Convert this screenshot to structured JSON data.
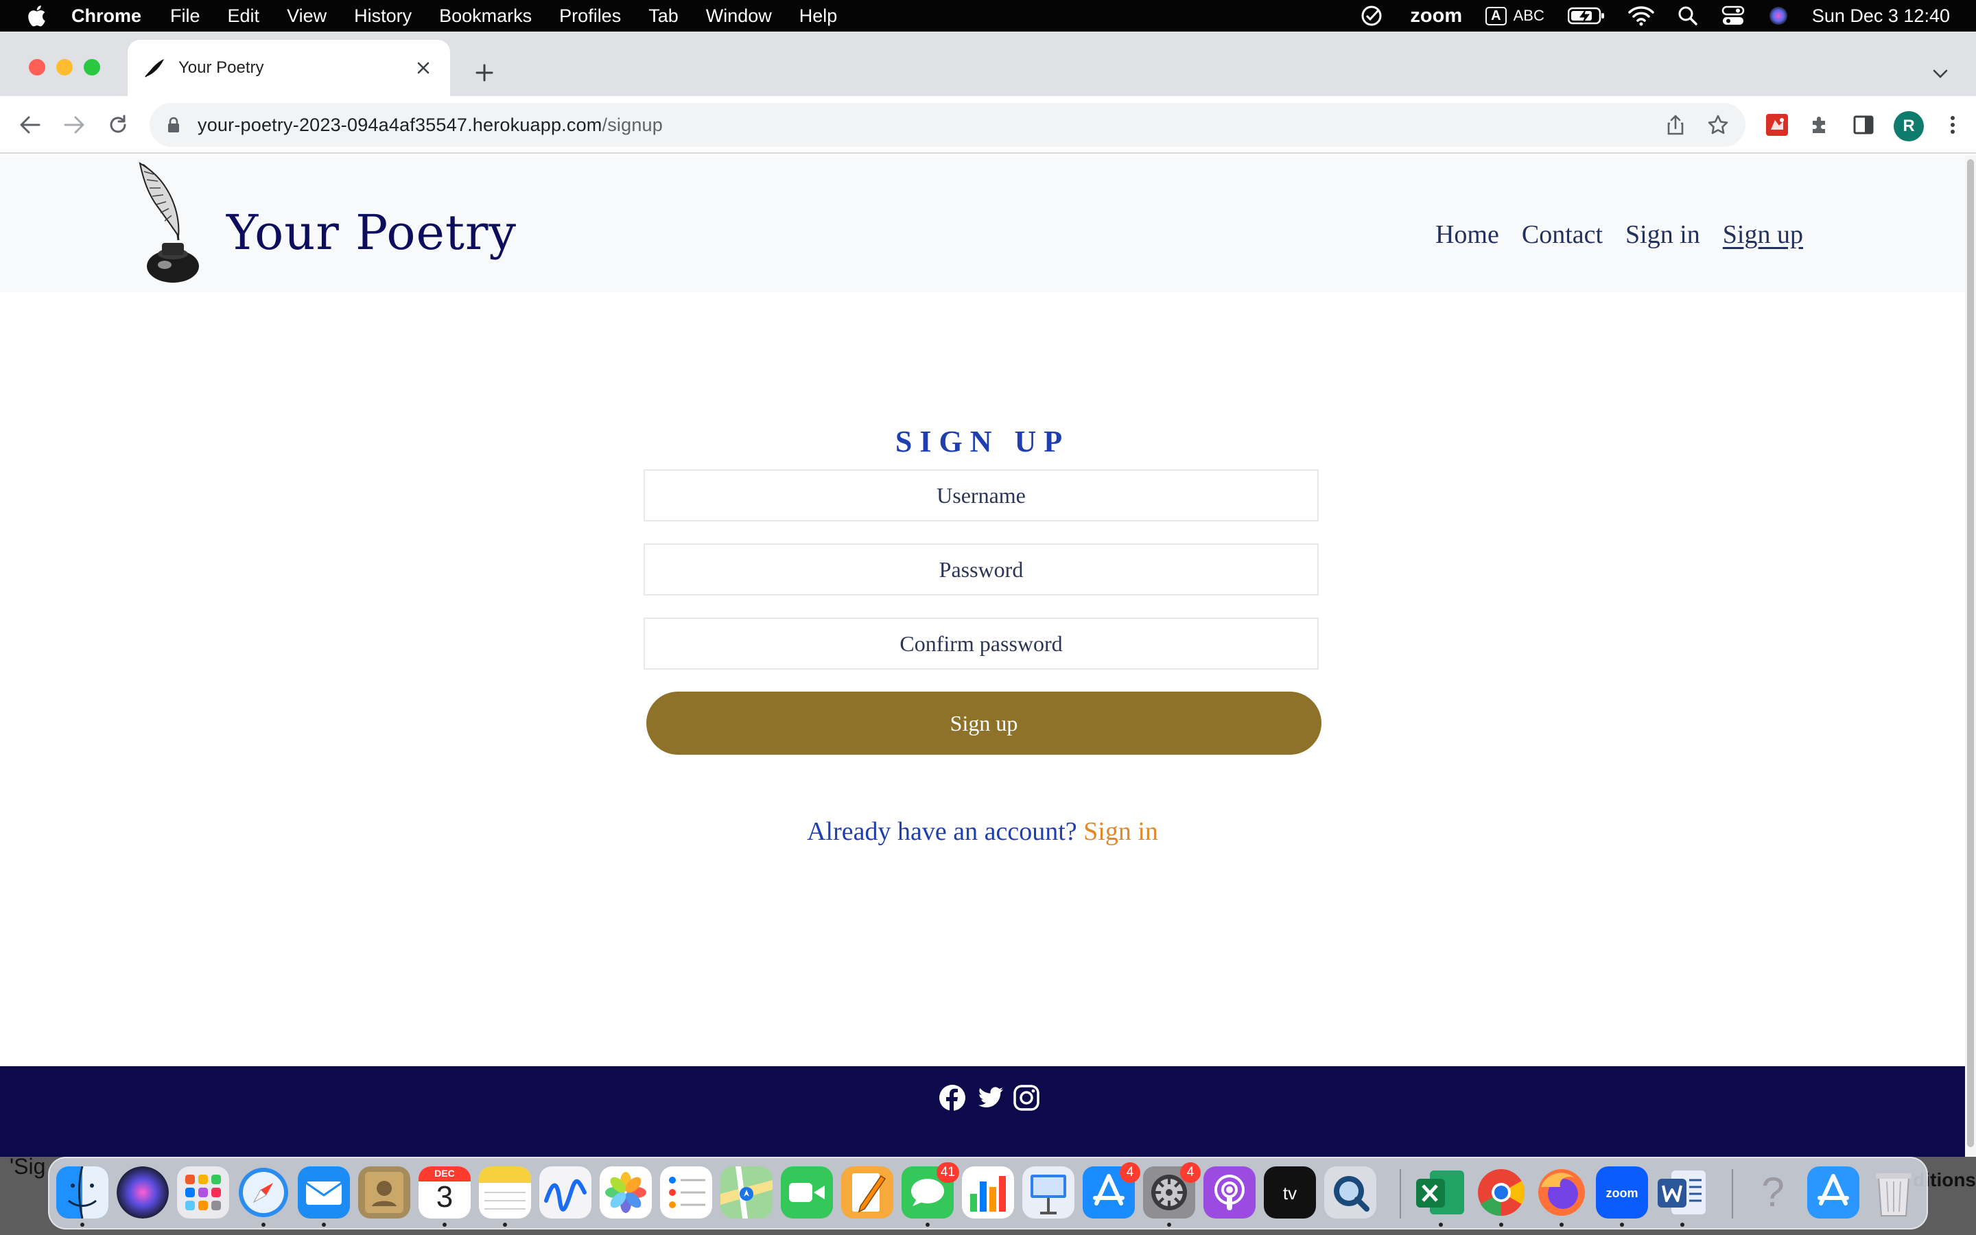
{
  "menubar": {
    "app_name": "Chrome",
    "items": [
      "File",
      "Edit",
      "View",
      "History",
      "Bookmarks",
      "Profiles",
      "Tab",
      "Window",
      "Help"
    ],
    "zoom_label": "zoom",
    "input_source": "A",
    "input_label": "ABC",
    "clock": "Sun Dec 3  12:40"
  },
  "browser": {
    "tab_title": "Your Poetry",
    "url_host": "your-poetry-2023-094a4af35547.herokuapp.com",
    "url_path": "/signup",
    "profile_initial": "R"
  },
  "site": {
    "brand": "Your Poetry",
    "nav": [
      {
        "label": "Home",
        "active": false
      },
      {
        "label": "Contact",
        "active": false
      },
      {
        "label": "Sign in",
        "active": false
      },
      {
        "label": "Sign up",
        "active": true
      }
    ]
  },
  "form": {
    "heading": "SIGN UP",
    "username_placeholder": "Username",
    "password_placeholder": "Password",
    "confirm_placeholder": "Confirm password",
    "submit_label": "Sign up",
    "already_text": "Already have an account?",
    "signin_link": "Sign in"
  },
  "footer": {
    "social_icons": [
      "facebook-icon",
      "twitter-icon",
      "instagram-icon"
    ]
  },
  "dock": {
    "left_snippet": "'Sig",
    "right_snippet": "ditions",
    "calendar_month": "DEC",
    "calendar_day": "3",
    "badges": {
      "messages": "41",
      "app_store": "4",
      "system_settings": "4"
    }
  },
  "colors": {
    "brand_navy": "#0d0d5e",
    "heading_blue": "#1f3fae",
    "button_gold": "#8e7229",
    "link_orange": "#e0892a",
    "footer_navy": "#0c0a4a"
  }
}
